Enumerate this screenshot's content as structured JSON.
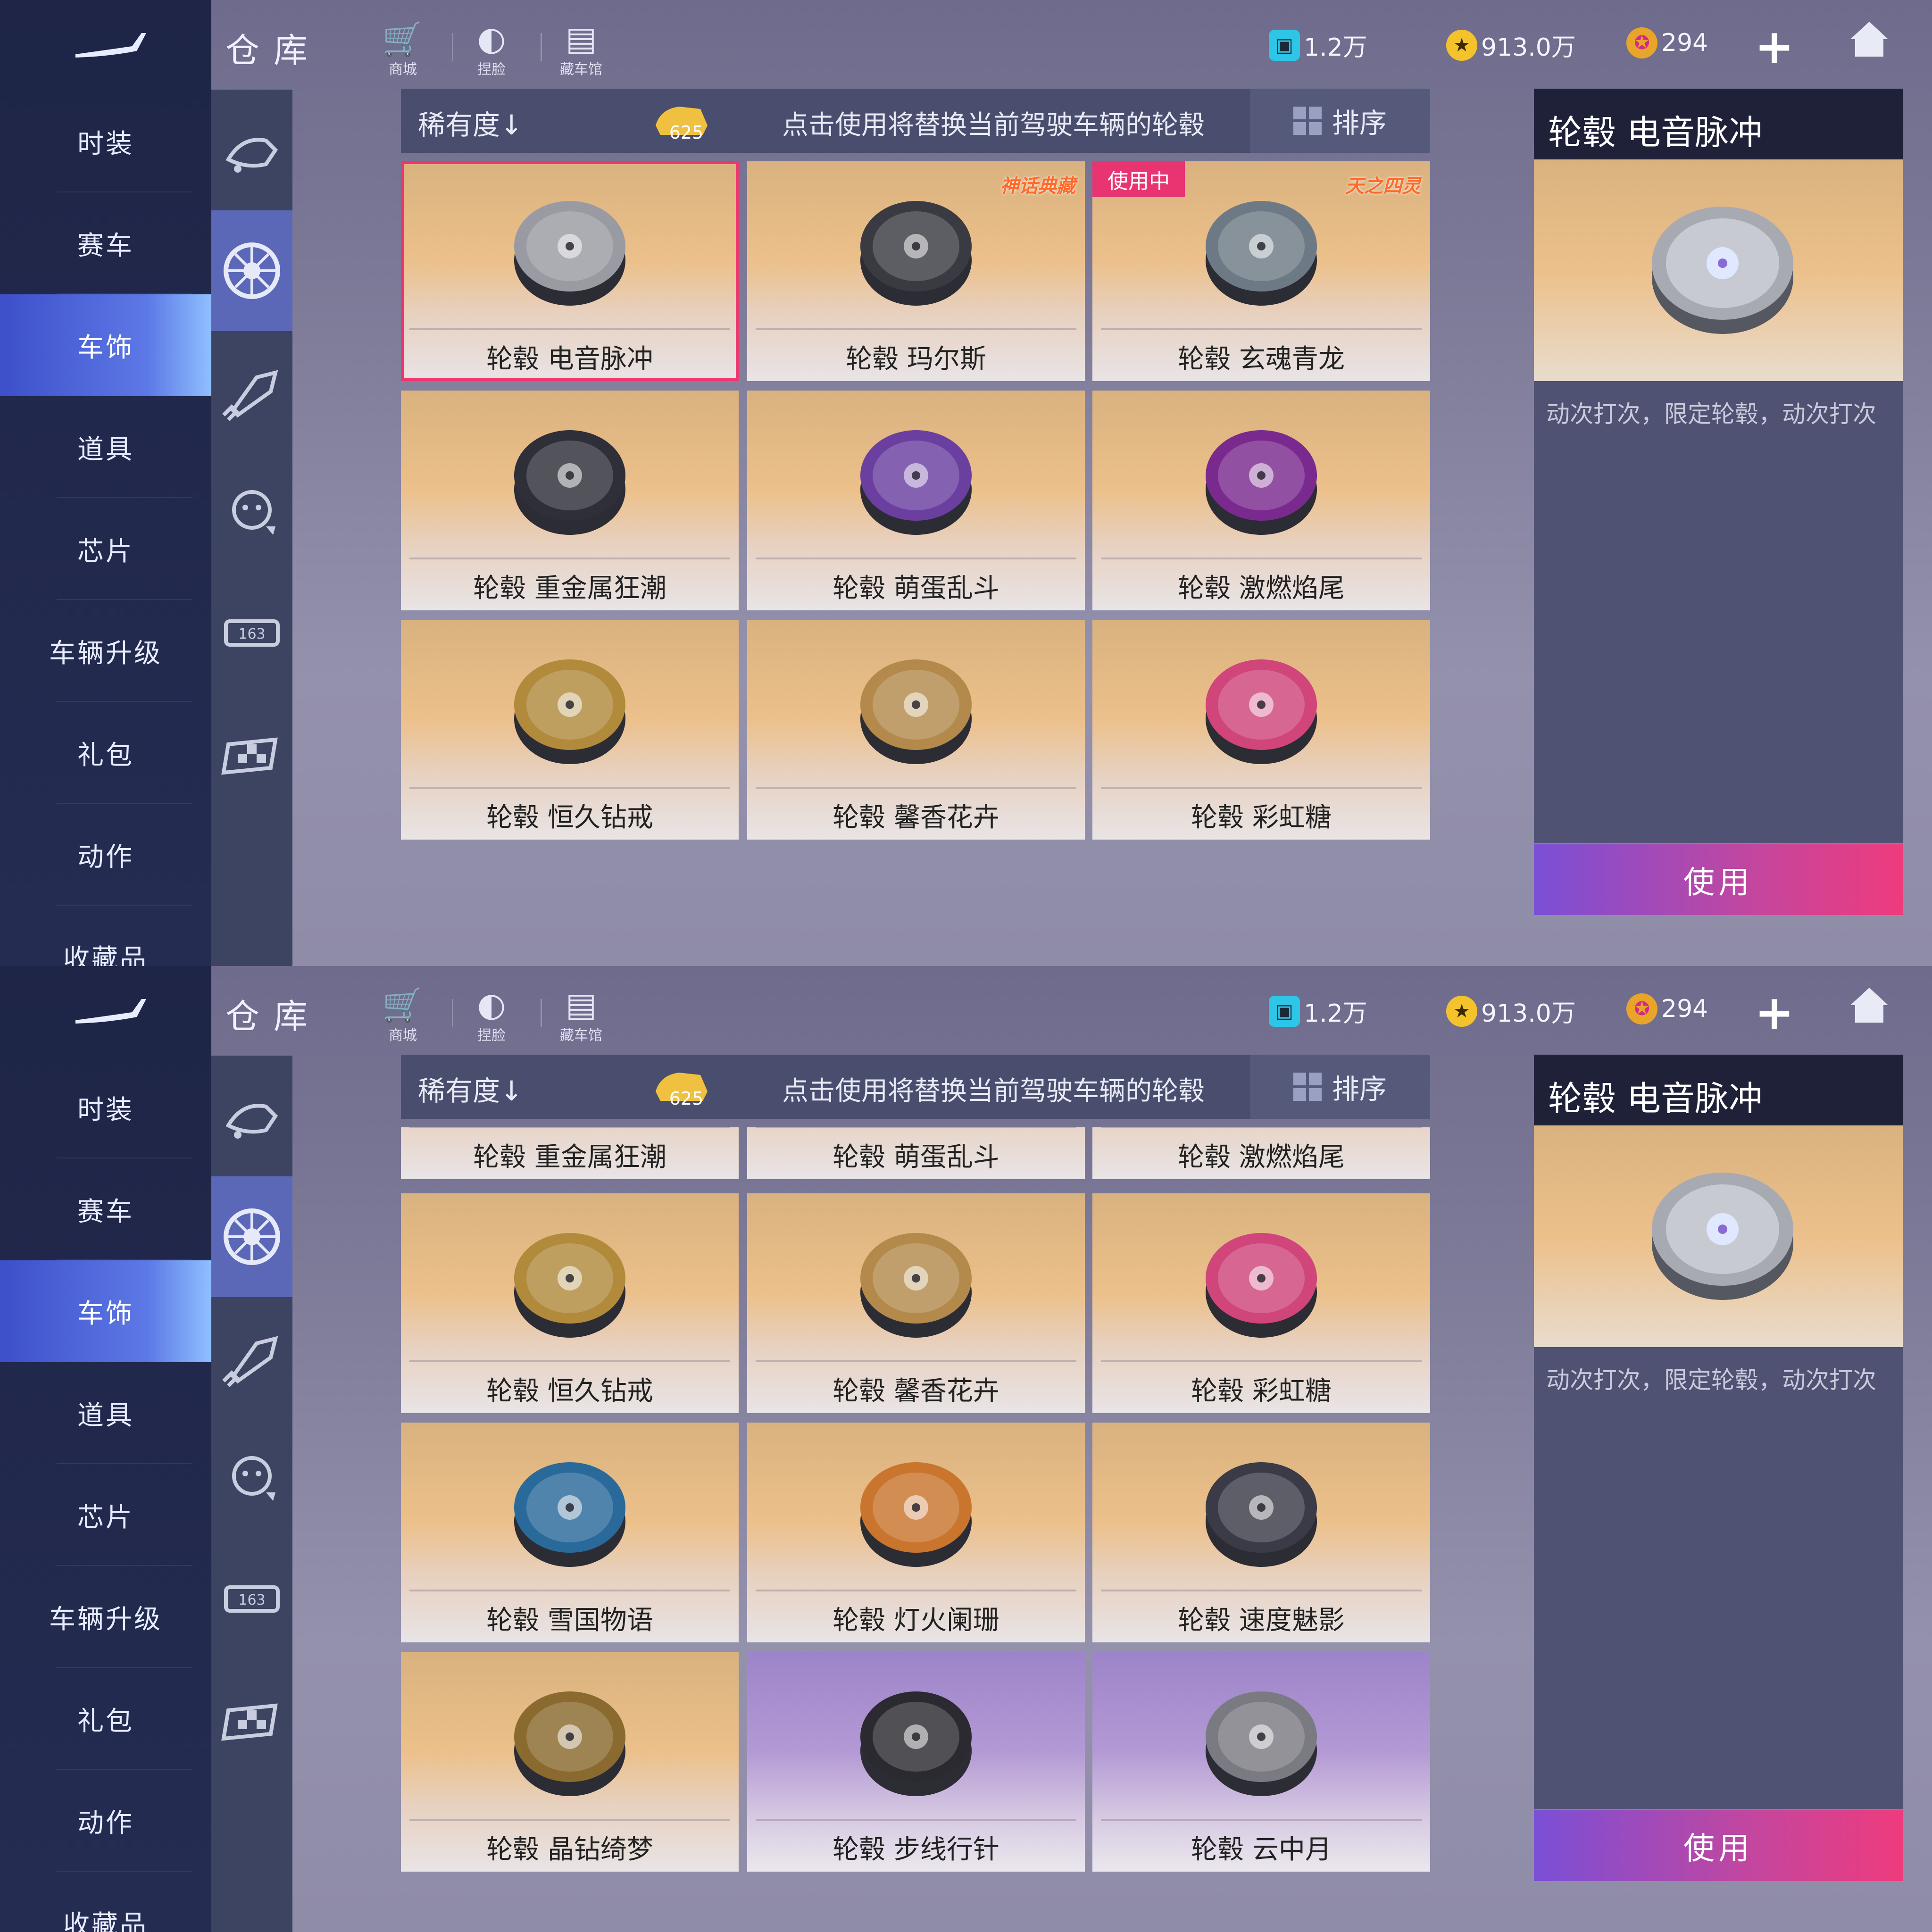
{
  "header": {
    "title": "仓库",
    "shop_label": "商城",
    "face_label": "捏脸",
    "garage_label": "藏车馆",
    "ticket_value": "1.2万",
    "coin_value": "913.0万",
    "gem_value": "294"
  },
  "nav": [
    "时装",
    "赛车",
    "车饰",
    "道具",
    "芯片",
    "车辆升级",
    "礼包",
    "动作",
    "收藏品"
  ],
  "nav_active": "车饰",
  "toolbar": {
    "sort_key": "稀有度↓",
    "ticket_count": "625",
    "hint": "点击使用将替换当前驾驶车辆的轮毂",
    "sort_button": "排序"
  },
  "detail": {
    "title": "轮毂 电音脉冲",
    "desc": "动次打次，限定轮毂，动次打次",
    "use_button": "使用"
  },
  "top_items": [
    {
      "name": "轮毂 电音脉冲",
      "color": "#9a9aa3",
      "selected": true
    },
    {
      "name": "轮毂 玛尔斯",
      "color": "#3a3a42",
      "badge": "神话典藏"
    },
    {
      "name": "轮毂 玄魂青龙",
      "color": "#6d7a86",
      "tag": "使用中",
      "badge": "天之四灵"
    },
    {
      "name": "轮毂 重金属狂潮",
      "color": "#2e2f38"
    },
    {
      "name": "轮毂 萌蛋乱斗",
      "color": "#6a3fa0"
    },
    {
      "name": "轮毂 激燃焰尾",
      "color": "#7a2a8e"
    },
    {
      "name": "轮毂 恒久钻戒",
      "color": "#b18a3c"
    },
    {
      "name": "轮毂 馨香花卉",
      "color": "#b38a4c"
    },
    {
      "name": "轮毂 彩虹糖",
      "color": "#d0457a"
    }
  ],
  "bottom_partial_row": [
    "轮毂 重金属狂潮",
    "轮毂 萌蛋乱斗",
    "轮毂 激燃焰尾"
  ],
  "bottom_items": [
    {
      "name": "轮毂 恒久钻戒",
      "color": "#b18a3c"
    },
    {
      "name": "轮毂 馨香花卉",
      "color": "#b38a4c"
    },
    {
      "name": "轮毂 彩虹糖",
      "color": "#d0457a"
    },
    {
      "name": "轮毂 雪国物语",
      "color": "#2a6a9a"
    },
    {
      "name": "轮毂 灯火阑珊",
      "color": "#c9752e"
    },
    {
      "name": "轮毂 速度魅影",
      "color": "#3b3b48"
    },
    {
      "name": "轮毂 晶钻绮梦",
      "color": "#8a6a2e"
    },
    {
      "name": "轮毂 步线行针",
      "color": "#2a2a30",
      "purple": true
    },
    {
      "name": "轮毂 云中月",
      "color": "#7a7a82",
      "purple": true
    }
  ],
  "colors": {
    "accent": "#5d79e6",
    "use_button": "#ef3b7d",
    "in_use_tag": "#e83572"
  }
}
